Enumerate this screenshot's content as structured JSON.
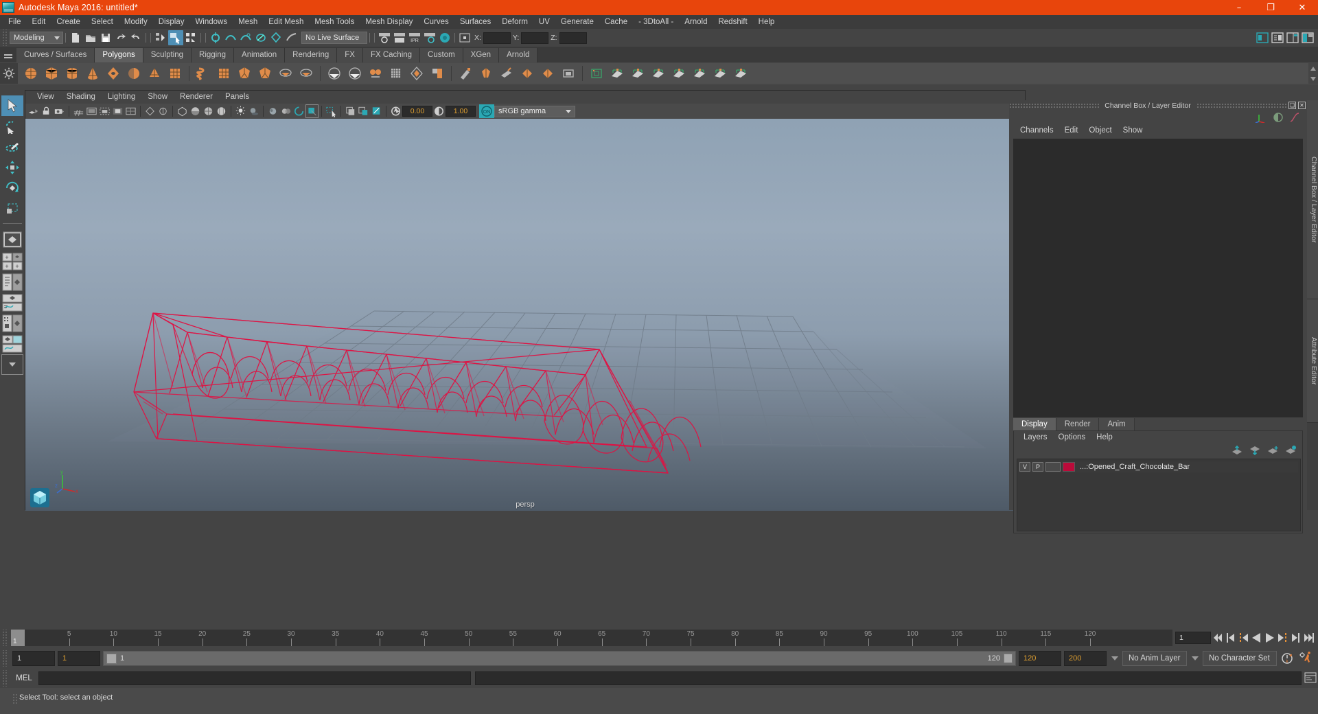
{
  "window": {
    "title": "Autodesk Maya 2016: untitled*",
    "logo_icon": "maya-logo-icon",
    "controls": [
      {
        "name": "minimize-button",
        "glyph": "–"
      },
      {
        "name": "maximize-button",
        "glyph": "❐"
      },
      {
        "name": "close-button",
        "glyph": "✕"
      }
    ]
  },
  "main_menu": {
    "items": [
      "File",
      "Edit",
      "Create",
      "Select",
      "Modify",
      "Display",
      "Windows",
      "Mesh",
      "Edit Mesh",
      "Mesh Tools",
      "Mesh Display",
      "Curves",
      "Surfaces",
      "Deform",
      "UV",
      "Generate",
      "Cache",
      "- 3DtoAll -",
      "Arnold",
      "Redshift",
      "Help"
    ]
  },
  "status_line": {
    "menuset_value": "Modeling",
    "live_surface_value": "No Live Surface",
    "coord_labels": [
      "X:",
      "Y:",
      "Z:"
    ],
    "coord_values": [
      "",
      "",
      ""
    ],
    "icons": [
      "new-scene-icon",
      "open-scene-icon",
      "save-scene-icon",
      "undo-icon",
      "redo-icon",
      "select-hierarchy-icon",
      "select-object-icon",
      "select-component-icon",
      "snap-to-grid-icon",
      "snap-to-curve-icon",
      "snap-to-point-icon",
      "snap-to-projected-center-icon",
      "snap-to-view-plane-icon",
      "make-live-icon",
      "show-hide-render-view-icon",
      "render-current-frame-icon",
      "ipr-render-icon",
      "render-settings-icon",
      "hypershade-icon",
      "open-outliner-icon",
      "open-attribute-editor-icon",
      "open-tool-settings-icon",
      "open-channel-box-icon"
    ]
  },
  "shelf": {
    "tabs": [
      "Curves / Surfaces",
      "Polygons",
      "Sculpting",
      "Rigging",
      "Animation",
      "Rendering",
      "FX",
      "FX Caching",
      "Custom",
      "XGen",
      "Arnold"
    ],
    "active_tab": "Polygons",
    "icons": [
      "poly-sphere-icon",
      "poly-cube-icon",
      "poly-cylinder-icon",
      "poly-cone-icon",
      "poly-torus-icon",
      "poly-plane-icon",
      "poly-pyramid-icon",
      "poly-prism-icon",
      "poly-helix-icon",
      "poly-pipe-icon",
      "poly-soccer-ball-icon",
      "poly-platonic-icon",
      "poly-combine-icon",
      "poly-separate-icon",
      "poly-booleans-icon",
      "poly-smooth-icon",
      "poly-bevel-icon",
      "poly-extrude-icon",
      "poly-bridge-icon",
      "poly-append-icon",
      "poly-sculpt-icon",
      "poly-quad-draw-icon",
      "poly-multi-cut-icon",
      "poly-target-weld-icon",
      "poly-mirror-icon",
      "poly-transfer-icon",
      "uv-editor-icon",
      "uv-planar-icon",
      "uv-cylindrical-icon",
      "uv-spherical-icon",
      "uv-automatic-icon",
      "uv-unfold-icon",
      "uv-layout-icon",
      "uv-cut-icon"
    ],
    "gear_icon": "shelf-options-gear-icon"
  },
  "toolbox": {
    "items": [
      {
        "name": "select-tool",
        "icon": "arrow-cursor-icon",
        "selected": true
      },
      {
        "name": "lasso-select-tool",
        "icon": "lasso-icon",
        "selected": false
      },
      {
        "name": "paint-select-tool",
        "icon": "paint-brush-icon",
        "selected": false
      },
      {
        "name": "move-tool",
        "icon": "move-arrows-icon",
        "selected": false
      },
      {
        "name": "rotate-tool",
        "icon": "rotate-circle-icon",
        "selected": false
      },
      {
        "name": "scale-tool",
        "icon": "scale-box-icon",
        "selected": false
      }
    ],
    "layouts": [
      {
        "name": "single-perspective-layout",
        "icon": "single-pane-icon"
      },
      {
        "name": "four-view-layout",
        "icon": "four-pane-icon"
      },
      {
        "name": "outliner-persp-layout",
        "icon": "outliner-persp-icon"
      },
      {
        "name": "persp-graph-layout",
        "icon": "persp-graph-icon"
      },
      {
        "name": "hypershade-persp-layout",
        "icon": "hypershade-persp-icon"
      },
      {
        "name": "persp-graph-outliner-layout",
        "icon": "persp-graph-outliner-icon"
      },
      {
        "name": "more-layouts",
        "icon": "chevron-down-icon"
      }
    ]
  },
  "viewport": {
    "menu": [
      "View",
      "Shading",
      "Lighting",
      "Show",
      "Renderer",
      "Panels"
    ],
    "camera_label": "persp",
    "toolbar": {
      "icons": [
        "select-camera-icon",
        "lock-camera-icon",
        "camera-attributes-icon",
        "grid-toggle-icon",
        "film-gate-icon",
        "resolution-gate-icon",
        "gate-mask-icon",
        "field-chart-icon",
        "safe-action-icon",
        "safe-title-icon",
        "wireframe-icon",
        "smooth-shade-icon",
        "shaded-wireframe-icon",
        "textured-icon",
        "use-all-lights-icon",
        "shadows-icon",
        "screen-space-ao-icon",
        "motion-blur-icon",
        "multisample-icon",
        "isolate-select-icon",
        "xray-icon",
        "xray-joints-icon",
        "xray-active-components-icon",
        "exposure-icon",
        "gamma-icon",
        "color-management-toggle-icon"
      ],
      "exposure_value": "0.00",
      "gamma_value": "1.00",
      "color_mgmt_toggle": "ON",
      "view_transform": "sRGB gamma"
    },
    "axis_gizmo_labels": [
      "y",
      "x",
      "z"
    ],
    "model_color": "#e01243",
    "grid_color": "#6f7b88",
    "bg_top": "#8fa2b4",
    "bg_bottom": "#4e5a67"
  },
  "right_panel": {
    "title": "Channel Box / Layer Editor",
    "window_buttons": [
      {
        "name": "undock-panel-button",
        "glyph": "❏"
      },
      {
        "name": "close-panel-button",
        "glyph": "✕"
      }
    ],
    "quick_icons": [
      "channel-box-axis-icon",
      "channel-box-sphere-icon",
      "channel-box-curve-icon"
    ],
    "channel_menu": [
      "Channels",
      "Edit",
      "Object",
      "Show"
    ],
    "layer_editor": {
      "tabs": [
        "Display",
        "Render",
        "Anim"
      ],
      "active_tab": "Display",
      "menu": [
        "Layers",
        "Options",
        "Help"
      ],
      "buttons": [
        "move-layer-up-icon",
        "move-layer-down-icon",
        "create-new-layer-icon",
        "create-layer-from-selected-icon"
      ],
      "layers": [
        {
          "visibility": "V",
          "playback": "P",
          "shading": "",
          "color": "#bb0b3a",
          "name": "...:Opened_Craft_Chocolate_Bar"
        }
      ]
    }
  },
  "right_vertical_tabs": [
    "Channel Box / Layer Editor",
    "Attribute Editor"
  ],
  "time_slider": {
    "current_frame": "1",
    "ticks": [
      5,
      10,
      15,
      20,
      25,
      30,
      35,
      40,
      45,
      50,
      55,
      60,
      65,
      70,
      75,
      80,
      85,
      90,
      95,
      100,
      105,
      110,
      115,
      120
    ],
    "end_marker": "120",
    "current_frame_field": "1",
    "playback_buttons": [
      {
        "name": "go-to-start-button",
        "icon": "skip-start-icon"
      },
      {
        "name": "step-back-keyframe-button",
        "icon": "prev-key-icon"
      },
      {
        "name": "step-back-frame-button",
        "icon": "prev-frame-icon"
      },
      {
        "name": "play-backwards-button",
        "icon": "play-reverse-icon"
      },
      {
        "name": "play-forwards-button",
        "icon": "play-forward-icon"
      },
      {
        "name": "step-forward-frame-button",
        "icon": "next-frame-icon"
      },
      {
        "name": "step-forward-keyframe-button",
        "icon": "next-key-icon"
      },
      {
        "name": "go-to-end-button",
        "icon": "skip-end-icon"
      }
    ]
  },
  "range_slider": {
    "anim_start": "1",
    "range_start": "1",
    "bar_start_label": "1",
    "bar_end_label": "120",
    "range_end": "120",
    "anim_end": "200",
    "anim_layer": "No Anim Layer",
    "character_set": "No Character Set",
    "auto_key_icon": "auto-keyframe-icon",
    "anim_prefs_icon": "animation-preferences-icon"
  },
  "command_line": {
    "language_label": "MEL",
    "input_value": "",
    "output_value": "",
    "script_editor_icon": "script-editor-icon"
  },
  "help_line": {
    "message": "Select Tool: select an object"
  }
}
